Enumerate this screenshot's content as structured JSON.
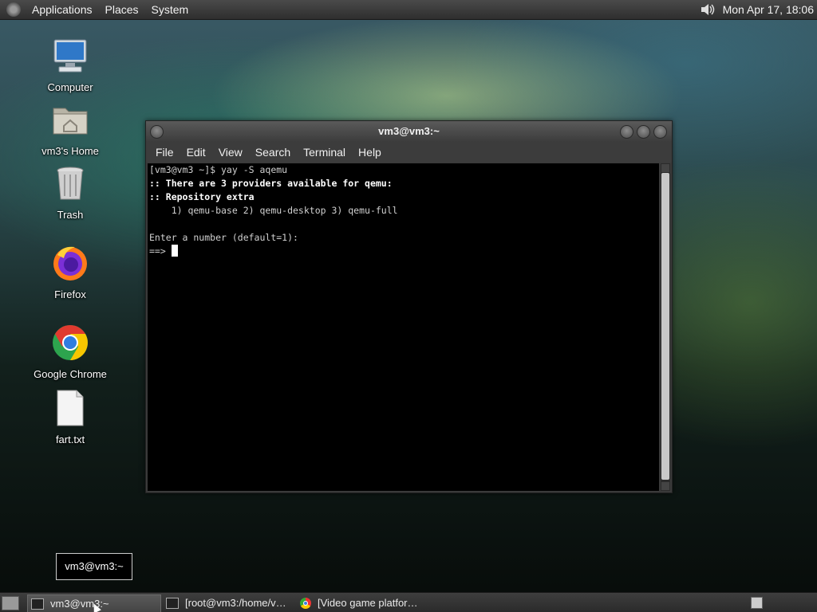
{
  "top_panel": {
    "menus": [
      "Applications",
      "Places",
      "System"
    ],
    "clock": "Mon Apr 17, 18:06"
  },
  "desktop_icons": [
    {
      "label": "Computer",
      "icon": "computer-icon"
    },
    {
      "label": "vm3's Home",
      "icon": "home-folder-icon"
    },
    {
      "label": "Trash",
      "icon": "trash-icon"
    },
    {
      "label": "Firefox",
      "icon": "firefox-icon"
    },
    {
      "label": "Google Chrome",
      "icon": "chrome-icon"
    },
    {
      "label": "fart.txt",
      "icon": "text-file-icon"
    }
  ],
  "terminal": {
    "title": "vm3@vm3:~",
    "menus": [
      "File",
      "Edit",
      "View",
      "Search",
      "Terminal",
      "Help"
    ],
    "lines": [
      {
        "text": "[vm3@vm3 ~]$ yay -S aqemu",
        "bold": false
      },
      {
        "text": ":: There are 3 providers available for qemu:",
        "bold": true
      },
      {
        "text": ":: Repository extra",
        "bold": true
      },
      {
        "text": "    1) qemu-base 2) qemu-desktop 3) qemu-full",
        "bold": false
      },
      {
        "text": "",
        "bold": false
      },
      {
        "text": "Enter a number (default=1):",
        "bold": false
      }
    ],
    "prompt": "==> "
  },
  "tooltip": "vm3@vm3:~",
  "taskbar": [
    {
      "label": "vm3@vm3:~",
      "active": true
    },
    {
      "label": "[root@vm3:/home/v…",
      "active": false
    },
    {
      "label": "[Video game platfor…",
      "active": false
    }
  ]
}
